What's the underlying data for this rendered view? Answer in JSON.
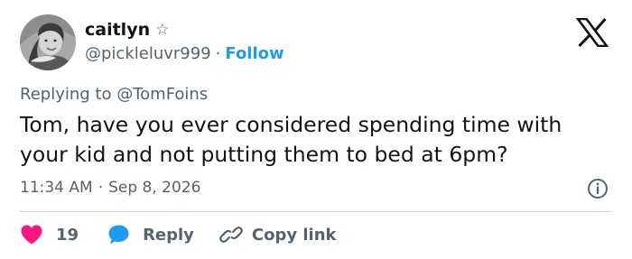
{
  "author": {
    "display_name": "caitlyn",
    "badge_glyph": "☆",
    "handle": "@pickleluvr999",
    "separator": "·",
    "follow_label": "Follow"
  },
  "reply_context": {
    "prefix": "Replying to",
    "mention": "@TomFoins"
  },
  "tweet": {
    "text": "Tom, have you ever considered spending time with your kid and not putting them to bed at 6pm?",
    "time": "11:34 AM",
    "separator": "·",
    "date": "Sep 8, 2026"
  },
  "actions": {
    "like_count": "19",
    "reply_label": "Reply",
    "copy_label": "Copy link"
  },
  "colors": {
    "accent": "#1d9bf0",
    "like": "#f91880",
    "text": "#0f1419",
    "muted": "#536471",
    "divider": "#cfd9de"
  },
  "icons": {
    "brand": "x-logo-icon",
    "info": "info-icon",
    "like": "heart-icon",
    "reply": "speech-bubble-icon",
    "copy": "link-icon"
  }
}
